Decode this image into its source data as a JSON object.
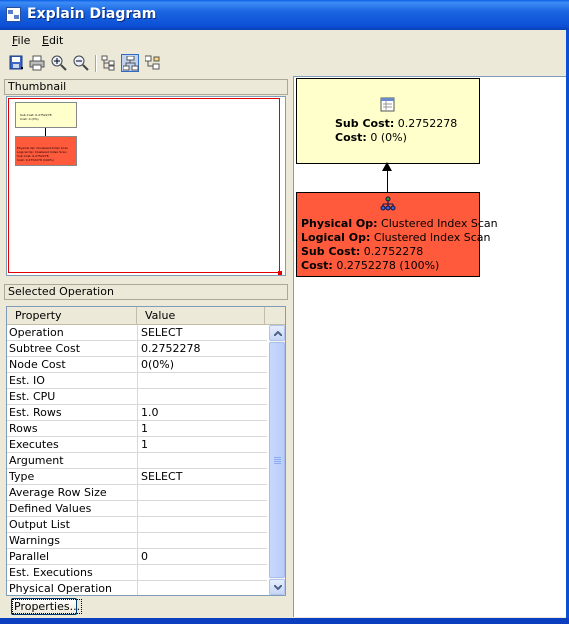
{
  "window": {
    "title": "Explain Diagram"
  },
  "menu": [
    {
      "label": "File",
      "mnemonic": "F",
      "rest": "ile"
    },
    {
      "label": "Edit",
      "mnemonic": "E",
      "rest": "dit"
    }
  ],
  "toolbar": {
    "buttons": [
      {
        "name": "save-icon"
      },
      {
        "name": "print-icon"
      },
      {
        "name": "zoom-in-icon"
      },
      {
        "name": "zoom-out-icon"
      },
      {
        "name": "tree-layout-icon"
      },
      {
        "name": "vertical-layout-icon",
        "pressed": true
      },
      {
        "name": "horizontal-layout-icon"
      }
    ]
  },
  "thumbnail": {
    "header": "Thumbnail",
    "top_node": {
      "sub_cost": "Sub Cost: 0.2752278",
      "cost": "Cost: 0 (0%)"
    },
    "bottom_node": {
      "physical": "Physical Op: Clustered Index Scan",
      "logical": "Logical Op: Clustered Index Scan",
      "sub_cost": "Sub Cost: 0.2752278",
      "cost": "Cost: 0.2752278 (100%)"
    }
  },
  "selected_operation": {
    "header": "Selected Operation",
    "columns": [
      "Property",
      "Value"
    ],
    "rows": [
      {
        "property": "Operation",
        "value": "SELECT"
      },
      {
        "property": "Subtree Cost",
        "value": "0.2752278"
      },
      {
        "property": "Node Cost",
        "value": "0(0%)"
      },
      {
        "property": "Est. IO",
        "value": ""
      },
      {
        "property": "Est. CPU",
        "value": ""
      },
      {
        "property": "Est. Rows",
        "value": "1.0"
      },
      {
        "property": "Rows",
        "value": "1"
      },
      {
        "property": "Executes",
        "value": "1"
      },
      {
        "property": "Argument",
        "value": ""
      },
      {
        "property": "Type",
        "value": "SELECT"
      },
      {
        "property": "Average Row Size",
        "value": ""
      },
      {
        "property": "Defined Values",
        "value": ""
      },
      {
        "property": "Output List",
        "value": ""
      },
      {
        "property": "Warnings",
        "value": ""
      },
      {
        "property": "Parallel",
        "value": "0"
      },
      {
        "property": "Est. Executions",
        "value": ""
      },
      {
        "property": "Physical Operation",
        "value": ""
      }
    ],
    "properties_button": "Properties..."
  },
  "diagram": {
    "select_node": {
      "icon": "select-icon",
      "sub_cost_label": "Sub Cost:",
      "sub_cost_value": " 0.2752278",
      "cost_label": "Cost:",
      "cost_value": " 0 (0%)"
    },
    "scan_node": {
      "icon": "clustered-index-scan-icon",
      "physical_label": "Physical Op:",
      "physical_value": " Clustered Index Scan",
      "logical_label": "Logical Op:",
      "logical_value": " Clustered Index Scan",
      "sub_cost_label": "Sub Cost:",
      "sub_cost_value": " 0.2752278",
      "cost_label": "Cost:",
      "cost_value": " 0.2752278 (100%)"
    }
  },
  "colors": {
    "select_node": "#ffffcc",
    "scan_node": "#ff5a3c",
    "title_bar": "#0b4fd6"
  }
}
